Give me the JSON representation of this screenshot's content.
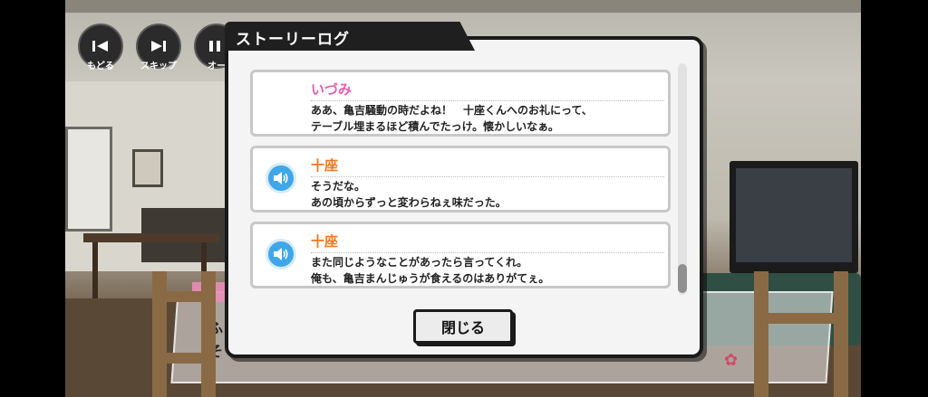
{
  "controls": [
    {
      "label": "もどる",
      "icon": "rewind-icon"
    },
    {
      "label": "スキップ",
      "icon": "skip-icon"
    },
    {
      "label": "オー",
      "icon": "auto-icon"
    }
  ],
  "background_text": {
    "line1": "ふ",
    "line2": "そ"
  },
  "story_log": {
    "title": "ストーリーログ",
    "entries": [
      {
        "speaker": "いづみ",
        "speaker_color": "#e060b0",
        "has_voice": false,
        "line1": "ああ、亀吉騒動の時だよね！　十座くんへのお礼にって、",
        "line2": "テーブル埋まるほど積んでたっけ。懐かしいなぁ。"
      },
      {
        "speaker": "十座",
        "speaker_color": "#f07820",
        "has_voice": true,
        "line1": "そうだな。",
        "line2": "あの頃からずっと変わらねぇ味だった。"
      },
      {
        "speaker": "十座",
        "speaker_color": "#f07820",
        "has_voice": true,
        "line1": "また同じようなことがあったら言ってくれ。",
        "line2": "俺も、亀吉まんじゅうが食えるのはありがてぇ。"
      }
    ],
    "close_label": "閉じる"
  },
  "colors": {
    "voice_button": "#3fa6e8",
    "modal_border": "#1a1a1a"
  }
}
